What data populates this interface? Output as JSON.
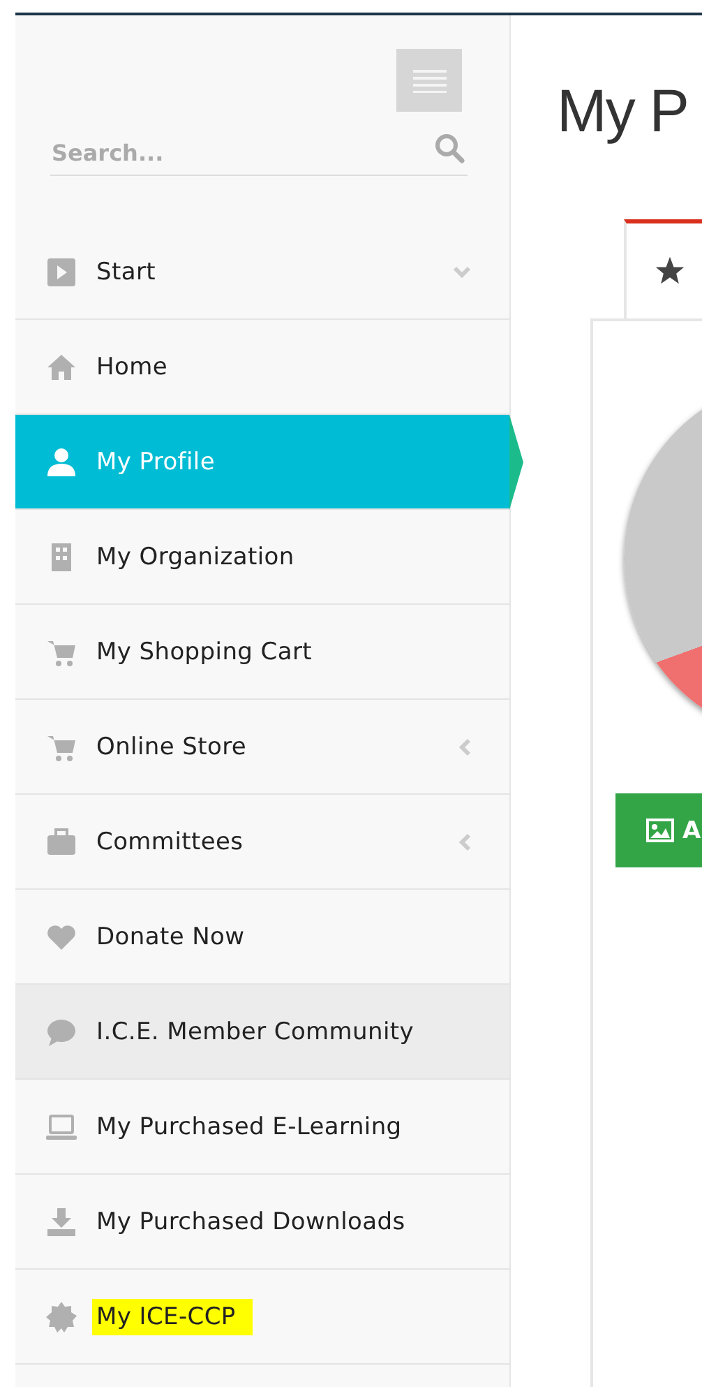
{
  "sidebar": {
    "search": {
      "placeholder": "Search..."
    },
    "items": [
      {
        "label": "Start",
        "kind": "play",
        "expanded": true,
        "selected": false,
        "hovered": false,
        "highlighted": false
      },
      {
        "label": "Home",
        "kind": "home",
        "selected": false,
        "hovered": false,
        "highlighted": false
      },
      {
        "label": "My Profile",
        "kind": "user",
        "selected": true,
        "hovered": false,
        "highlighted": false
      },
      {
        "label": "My Organization",
        "kind": "building",
        "selected": false,
        "hovered": false,
        "highlighted": false
      },
      {
        "label": "My Shopping Cart",
        "kind": "cart",
        "selected": false,
        "hovered": false,
        "highlighted": false
      },
      {
        "label": "Online Store",
        "kind": "cart",
        "expanded": false,
        "selected": false,
        "hovered": false,
        "highlighted": false
      },
      {
        "label": "Committees",
        "kind": "briefcase",
        "expanded": false,
        "selected": false,
        "hovered": false,
        "highlighted": false
      },
      {
        "label": "Donate Now",
        "kind": "heart",
        "selected": false,
        "hovered": false,
        "highlighted": false
      },
      {
        "label": "I.C.E. Member Community",
        "kind": "comment",
        "selected": false,
        "hovered": true,
        "highlighted": false
      },
      {
        "label": "My Purchased E-Learning",
        "kind": "laptop",
        "selected": false,
        "hovered": false,
        "highlighted": false
      },
      {
        "label": "My Purchased Downloads",
        "kind": "download",
        "selected": false,
        "hovered": false,
        "highlighted": false
      },
      {
        "label": "My ICE-CCP",
        "kind": "badge",
        "selected": false,
        "hovered": false,
        "highlighted": true
      }
    ]
  },
  "main": {
    "title": "My P",
    "tab": {
      "selected": true
    },
    "upload_button": {
      "label": "A"
    }
  }
}
